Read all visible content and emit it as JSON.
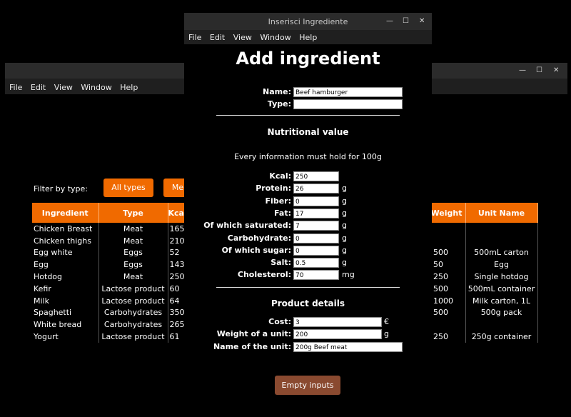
{
  "back_window": {
    "menu": [
      "File",
      "Edit",
      "View",
      "Window",
      "Help"
    ],
    "filter_label": "Filter by type:",
    "filter_buttons": [
      "All types",
      "Me"
    ],
    "left_headers": [
      "Ingredient",
      "Type",
      "Kca"
    ],
    "right_headers": [
      "Weight",
      "Unit Name"
    ],
    "rows": [
      {
        "ingredient": "Chicken Breast",
        "type": "Meat",
        "kcal": "165",
        "weight": "",
        "unit": ""
      },
      {
        "ingredient": "Chicken thighs",
        "type": "Meat",
        "kcal": "210",
        "weight": "",
        "unit": ""
      },
      {
        "ingredient": "Egg white",
        "type": "Eggs",
        "kcal": "52",
        "weight": "500",
        "unit": "500mL carton"
      },
      {
        "ingredient": "Egg",
        "type": "Eggs",
        "kcal": "143",
        "weight": "50",
        "unit": "Egg"
      },
      {
        "ingredient": "Hotdog",
        "type": "Meat",
        "kcal": "250",
        "weight": "250",
        "unit": "Single hotdog"
      },
      {
        "ingredient": "Kefir",
        "type": "Lactose product",
        "kcal": "60",
        "weight": "500",
        "unit": "500mL container"
      },
      {
        "ingredient": "Milk",
        "type": "Lactose product",
        "kcal": "64",
        "weight": "1000",
        "unit": "Milk carton, 1L"
      },
      {
        "ingredient": "Spaghetti",
        "type": "Carbohydrates",
        "kcal": "350",
        "weight": "500",
        "unit": "500g pack"
      },
      {
        "ingredient": "White bread",
        "type": "Carbohydrates",
        "kcal": "265",
        "weight": "",
        "unit": ""
      },
      {
        "ingredient": "Yogurt",
        "type": "Lactose product",
        "kcal": "61",
        "weight": "250",
        "unit": "250g container"
      }
    ]
  },
  "dialog": {
    "title": "Inserisci Ingrediente",
    "menu": [
      "File",
      "Edit",
      "View",
      "Window",
      "Help"
    ],
    "heading": "Add ingredient",
    "name_label": "Name:",
    "name_value": "Beef hamburger",
    "type_label": "Type:",
    "type_value": "",
    "nutri_title": "Nutritional value",
    "nutri_note": "Every information must hold for 100g",
    "nutri": [
      {
        "label": "Kcal:",
        "value": "250",
        "unit": ""
      },
      {
        "label": "Protein:",
        "value": "26",
        "unit": "g"
      },
      {
        "label": "Fiber:",
        "value": "0",
        "unit": "g"
      },
      {
        "label": "Fat:",
        "value": "17",
        "unit": "g"
      },
      {
        "label": "Of which saturated:",
        "value": "7",
        "unit": "g"
      },
      {
        "label": "Carbohydrate:",
        "value": "0",
        "unit": "g"
      },
      {
        "label": "Of which sugar:",
        "value": "0",
        "unit": "g"
      },
      {
        "label": "Salt:",
        "value": "0.5",
        "unit": "g"
      },
      {
        "label": "Cholesterol:",
        "value": "70",
        "unit": "mg"
      }
    ],
    "product_title": "Product details",
    "cost_label": "Cost:",
    "cost_value": "3",
    "cost_unit": "€",
    "weight_label": "Weight of a unit:",
    "weight_value": "200",
    "weight_unit": "g",
    "unitname_label": "Name of the unit:",
    "unitname_value": "200g Beef meat",
    "empty_button": "Empty inputs"
  },
  "colors": {
    "accent": "#f06a00",
    "button_muted": "#8a4a30"
  }
}
